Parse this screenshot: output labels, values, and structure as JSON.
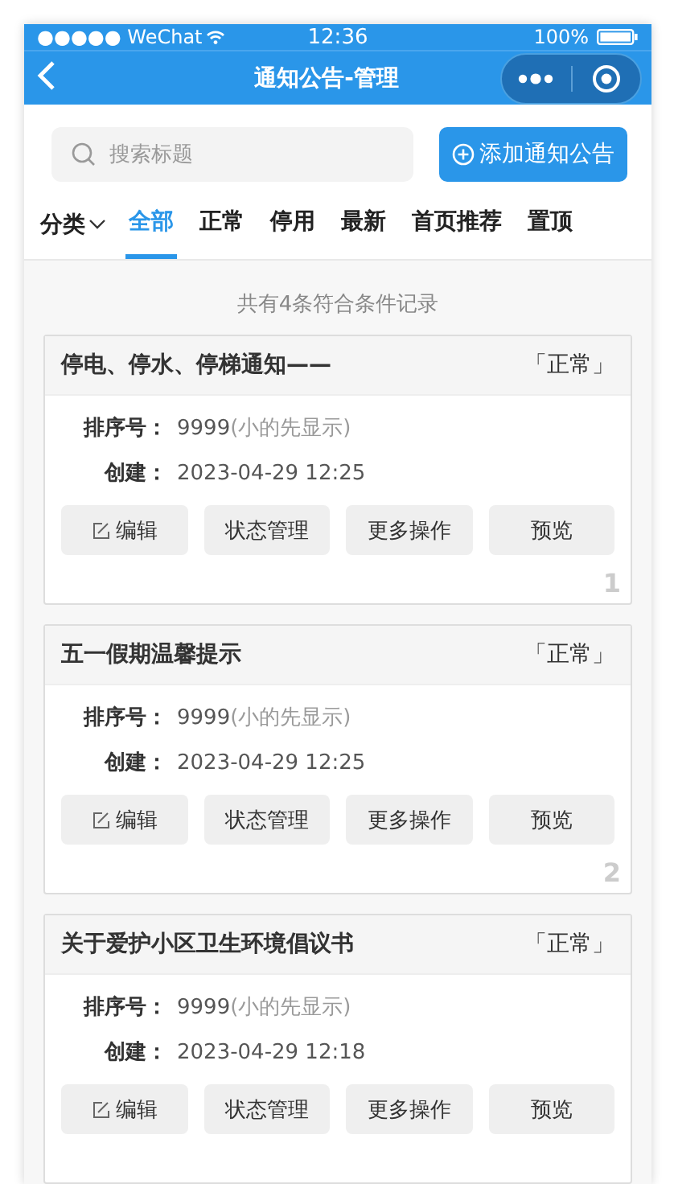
{
  "status_bar": {
    "carrier": "●●●●● WeChat",
    "time": "12:36",
    "battery": "100%"
  },
  "nav": {
    "title": "通知公告-管理"
  },
  "search": {
    "placeholder": "搜索标题"
  },
  "add_button": {
    "label": "添加通知公告"
  },
  "category": {
    "label": "分类"
  },
  "tabs": [
    {
      "label": "全部",
      "selected": true
    },
    {
      "label": "正常",
      "selected": false
    },
    {
      "label": "停用",
      "selected": false
    },
    {
      "label": "最新",
      "selected": false
    },
    {
      "label": "首页推荐",
      "selected": false
    },
    {
      "label": "置顶",
      "selected": false
    }
  ],
  "summary": "共有4条符合条件记录",
  "notices": [
    {
      "title": "停电、停水、停梯通知——",
      "status": "「正常」",
      "sort_label": "排序号：",
      "sort_value": "9999",
      "sort_note": "(小的先显示)",
      "created_label": "创建：",
      "created": "2023-04-29 12:25",
      "actions": [
        "编辑",
        "状态管理",
        "更多操作",
        "预览"
      ],
      "index": "1"
    },
    {
      "title": "五一假期温馨提示",
      "status": "「正常」",
      "sort_label": "排序号：",
      "sort_value": "9999",
      "sort_note": "(小的先显示)",
      "created_label": "创建：",
      "created": "2023-04-29 12:25",
      "actions": [
        "编辑",
        "状态管理",
        "更多操作",
        "预览"
      ],
      "index": "2"
    },
    {
      "title": "关于爱护小区卫生环境倡议书",
      "status": "「正常」",
      "sort_label": "排序号：",
      "sort_value": "9999",
      "sort_note": "(小的先显示)",
      "created_label": "创建：",
      "created": "2023-04-29 12:18",
      "actions": [
        "编辑",
        "状态管理",
        "更多操作",
        "预览"
      ]
    }
  ]
}
